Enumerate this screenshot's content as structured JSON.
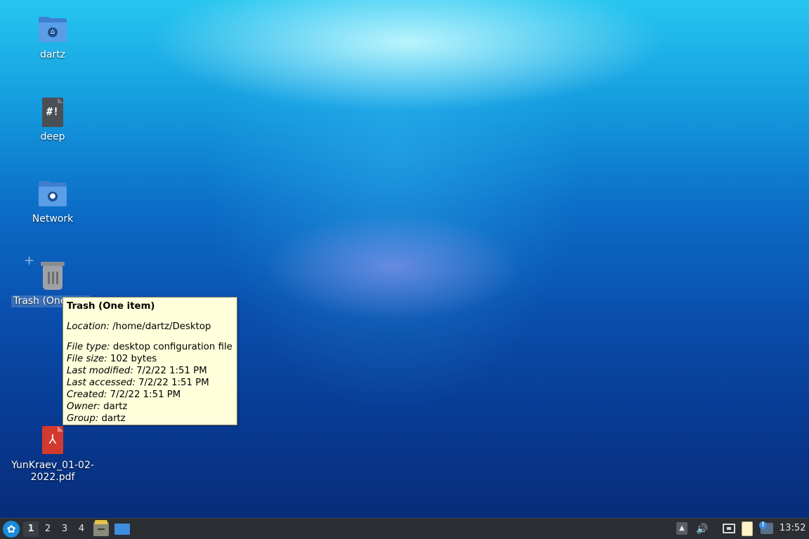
{
  "desktop": {
    "icons": [
      {
        "label": "dartz",
        "icon": "home-folder-icon"
      },
      {
        "label": "deep",
        "icon": "script-file-icon",
        "glyph": "#!"
      },
      {
        "label": "Network",
        "icon": "network-folder-icon"
      },
      {
        "label": "Trash (One item)",
        "label_visible": "Trash (One",
        "icon": "trash-icon"
      },
      {
        "label": "YunKraev_01-02-2022.pdf",
        "label_line1": "YunKraev_01-02-",
        "label_line2": "2022.pdf",
        "icon": "pdf-file-icon"
      }
    ]
  },
  "tooltip": {
    "title": "Trash (One item)",
    "location_label": "Location:",
    "location_value": "/home/dartz/Desktop",
    "file_type_label": "File type:",
    "file_type_value": "desktop configuration file",
    "file_size_label": "File size:",
    "file_size_value": "102 bytes",
    "last_modified_label": "Last modified:",
    "last_modified_value": "7/2/22 1:51 PM",
    "last_accessed_label": "Last accessed:",
    "last_accessed_value": "7/2/22 1:51 PM",
    "created_label": "Created:",
    "created_value": "7/2/22 1:51 PM",
    "owner_label": "Owner:",
    "owner_value": "dartz",
    "group_label": "Group:",
    "group_value": "dartz"
  },
  "taskbar": {
    "workspaces": [
      "1",
      "2",
      "3",
      "4"
    ],
    "active_workspace": "1",
    "launchers": [
      "file-manager-icon",
      "show-desktop-icon"
    ],
    "tray": [
      "show-hidden-icons-icon",
      "volume-icon",
      "network-icon",
      "clipboard-icon",
      "notifications-icon"
    ],
    "clock": "13:52",
    "accent": "#1c8adb"
  }
}
